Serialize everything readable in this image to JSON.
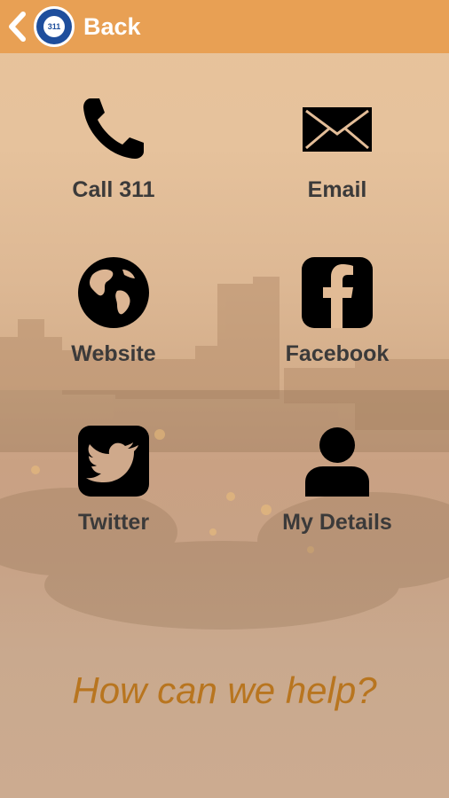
{
  "header": {
    "back_label": "Back",
    "logo_text": "311",
    "color": "#e8a054"
  },
  "tiles": [
    {
      "label": "Call 311",
      "icon": "phone-icon"
    },
    {
      "label": "Email",
      "icon": "envelope-icon"
    },
    {
      "label": "Website",
      "icon": "globe-icon"
    },
    {
      "label": "Facebook",
      "icon": "facebook-icon"
    },
    {
      "label": "Twitter",
      "icon": "twitter-icon"
    },
    {
      "label": "My Details",
      "icon": "user-icon"
    }
  ],
  "footer": {
    "help_text": "How can we help?",
    "color": "#b8751f"
  }
}
